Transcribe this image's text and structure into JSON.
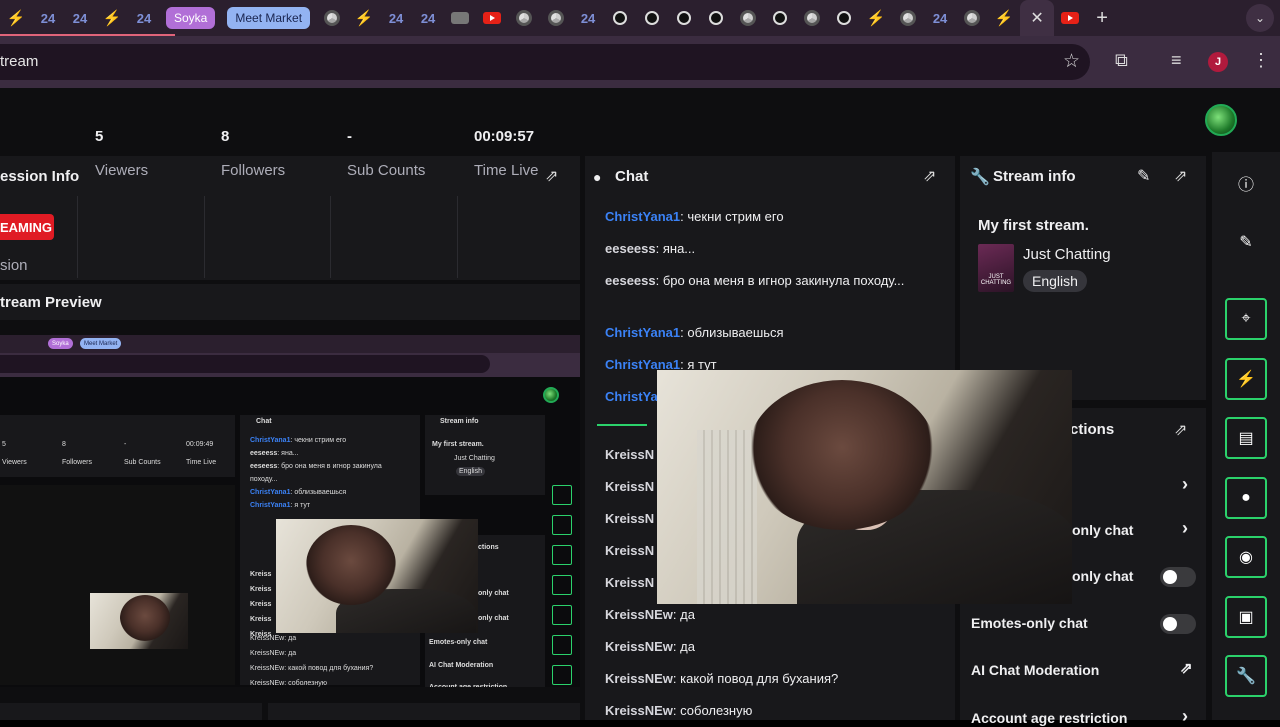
{
  "browser": {
    "tabs": [
      {
        "kind": "dash"
      },
      {
        "kind": "num",
        "text": "24"
      },
      {
        "kind": "num",
        "text": "24"
      },
      {
        "kind": "dash"
      },
      {
        "kind": "num",
        "text": "24"
      },
      {
        "kind": "pill-soyka",
        "text": "Soyka"
      },
      {
        "kind": "pill-market",
        "text": "Meet Market"
      },
      {
        "kind": "chrome"
      },
      {
        "kind": "dash"
      },
      {
        "kind": "num",
        "text": "24"
      },
      {
        "kind": "num",
        "text": "24"
      },
      {
        "kind": "grey"
      },
      {
        "kind": "yt"
      },
      {
        "kind": "chrome"
      },
      {
        "kind": "chrome"
      },
      {
        "kind": "num",
        "text": "24"
      },
      {
        "kind": "dot"
      },
      {
        "kind": "dot"
      },
      {
        "kind": "dot"
      },
      {
        "kind": "dot"
      },
      {
        "kind": "chrome"
      },
      {
        "kind": "dot"
      },
      {
        "kind": "chrome"
      },
      {
        "kind": "dot"
      },
      {
        "kind": "dash"
      },
      {
        "kind": "chrome"
      },
      {
        "kind": "num",
        "text": "24"
      },
      {
        "kind": "chrome"
      },
      {
        "kind": "dash"
      },
      {
        "kind": "active",
        "text": "✕"
      },
      {
        "kind": "yt"
      },
      {
        "kind": "plus",
        "text": "+"
      }
    ],
    "url": "tream",
    "avatar_letter": "J",
    "menu_icon": "⌄"
  },
  "session": {
    "title": "ession Info",
    "live_badge": "EAMING",
    "sub_label": "sion",
    "stats": [
      {
        "value": "5",
        "label": "Viewers"
      },
      {
        "value": "8",
        "label": "Followers"
      },
      {
        "value": "-",
        "label": "Sub Counts"
      },
      {
        "value": "00:09:57",
        "label": "Time Live"
      }
    ]
  },
  "preview": {
    "title": "tream Preview",
    "mini": {
      "soyka": "Soyka",
      "market": "Meet Market",
      "stats": [
        {
          "value": "5",
          "label": "Viewers"
        },
        {
          "value": "8",
          "label": "Followers"
        },
        {
          "value": "-",
          "label": "Sub Counts"
        },
        {
          "value": "00:09:49",
          "label": "Time Live"
        }
      ],
      "chat_title": "Chat",
      "stream_info_title": "Stream info",
      "stream_name": "My first stream.",
      "category": "Just Chatting",
      "language": "English",
      "lines": [
        {
          "u": "ChristYana1",
          "t": "чекни стрим его"
        },
        {
          "u": "eeseess",
          "t": "яна..."
        },
        {
          "u": "eeseess",
          "t": "бро она меня в игнор закинула"
        },
        {
          "u": "",
          "t": "походу..."
        },
        {
          "u": "ChristYana1",
          "t": "облизываешься"
        },
        {
          "u": "ChristYana1",
          "t": "я тут"
        }
      ],
      "kreiss": [
        "Kreiss",
        "Kreiss",
        "Kreiss",
        "Kreiss",
        "Kreiss"
      ],
      "kreiss_lines": [
        "KreissNEw: да",
        "KreissNEw: да",
        "KreissNEw: какой повод для бухания?",
        "KreissNEw: соболезную"
      ],
      "mod_items": [
        "ctions",
        "only chat",
        "only chat",
        "Emotes-only chat",
        "AI Chat Moderation",
        "Account age restriction"
      ]
    }
  },
  "chat": {
    "title": "Chat",
    "messages": [
      {
        "user": "ChristYana1",
        "color": "blue",
        "text": "чекни стрим его"
      },
      {
        "user": "eeseess",
        "color": "gray",
        "text": "яна..."
      },
      {
        "user": "eeseess",
        "color": "gray",
        "text": "бро она меня в игнор закинула походу..."
      },
      {
        "user": "ChristYana1",
        "color": "blue",
        "text": "облизываешься"
      },
      {
        "user": "ChristYana1",
        "color": "blue",
        "text": "я тут"
      },
      {
        "user": "ChristYa",
        "color": "blue",
        "text": ""
      },
      {
        "user": "KreissN",
        "color": "gray",
        "text": ""
      },
      {
        "user": "KreissN",
        "color": "gray",
        "text": ""
      },
      {
        "user": "KreissN",
        "color": "gray",
        "text": ""
      },
      {
        "user": "KreissN",
        "color": "gray",
        "text": ""
      },
      {
        "user": "KreissN",
        "color": "gray",
        "text": ""
      },
      {
        "user": "KreissNEw",
        "color": "gray",
        "text": "да"
      },
      {
        "user": "KreissNEw",
        "color": "gray",
        "text": "да"
      },
      {
        "user": "KreissNEw",
        "color": "gray",
        "text": "какой повод для бухания?"
      },
      {
        "user": "KreissNEw",
        "color": "gray",
        "text": "соболезную"
      }
    ]
  },
  "stream_info": {
    "title": "Stream info",
    "stream_title": "My first stream.",
    "category": "Just Chatting",
    "category_art_text": "JUST CHATTING",
    "language": "English"
  },
  "moderation": {
    "title": "ctions",
    "items": [
      {
        "label": "only chat",
        "control": "chevron"
      },
      {
        "label": "only chat",
        "control": "toggle"
      },
      {
        "label": "Emotes-only chat",
        "control": "toggle"
      },
      {
        "label": "AI Chat Moderation",
        "control": "external"
      },
      {
        "label": "Account age restriction",
        "control": "chevron"
      }
    ]
  },
  "rail": {
    "icons": [
      "info-icon",
      "pencil-icon",
      "focus-icon",
      "bolt-icon",
      "notes-icon",
      "chat-icon",
      "broadcast-icon",
      "camera-switch-icon",
      "wrench-icon"
    ],
    "accent": "#2bd16b"
  }
}
